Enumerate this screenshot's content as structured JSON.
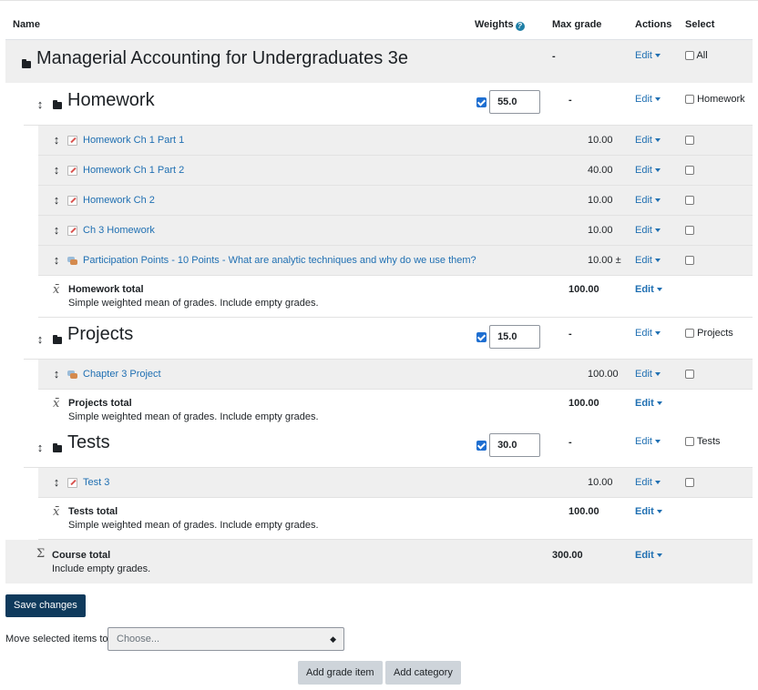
{
  "header": {
    "name": "Name",
    "weights": "Weights",
    "max_grade": "Max grade",
    "actions": "Actions",
    "select": "Select"
  },
  "course": {
    "title": "Managerial Accounting for Undergraduates 3e",
    "max": "-",
    "edit": "Edit",
    "select_label": "All"
  },
  "categories": [
    {
      "name": "Homework",
      "weight": "55.0",
      "max": "-",
      "edit": "Edit",
      "select_label": "Homework",
      "items": [
        {
          "name": "Homework Ch 1 Part 1",
          "max": "10.00",
          "edit": "Edit",
          "icon": "assignment"
        },
        {
          "name": "Homework Ch 1 Part 2",
          "max": "40.00",
          "edit": "Edit",
          "icon": "assignment"
        },
        {
          "name": "Homework Ch 2",
          "max": "10.00",
          "edit": "Edit",
          "icon": "assignment"
        },
        {
          "name": "Ch 3 Homework",
          "max": "10.00",
          "edit": "Edit",
          "icon": "assignment"
        },
        {
          "name": "Participation Points - 10 Points - What are analytic techniques and why do we use them?",
          "max": "10.00 ±",
          "edit": "Edit",
          "icon": "forum"
        }
      ],
      "total": {
        "name": "Homework total",
        "desc": "Simple weighted mean of grades. Include empty grades.",
        "max": "100.00",
        "edit": "Edit"
      }
    },
    {
      "name": "Projects",
      "weight": "15.0",
      "max": "-",
      "edit": "Edit",
      "select_label": "Projects",
      "items": [
        {
          "name": "Chapter 3 Project",
          "max": "100.00",
          "edit": "Edit",
          "icon": "forum"
        }
      ],
      "total": {
        "name": "Projects total",
        "desc": "Simple weighted mean of grades. Include empty grades.",
        "max": "100.00",
        "edit": "Edit"
      }
    },
    {
      "name": "Tests",
      "weight": "30.0",
      "max": "-",
      "edit": "Edit",
      "select_label": "Tests",
      "items": [
        {
          "name": "Test 3",
          "max": "10.00",
          "edit": "Edit",
          "icon": "assignment"
        }
      ],
      "total": {
        "name": "Tests total",
        "desc": "Simple weighted mean of grades. Include empty grades.",
        "max": "100.00",
        "edit": "Edit"
      }
    }
  ],
  "course_total": {
    "name": "Course total",
    "desc": "Include empty grades.",
    "max": "300.00",
    "edit": "Edit"
  },
  "footer": {
    "save_label": "Save changes",
    "move_label": "Move selected items to",
    "move_placeholder": "Choose...",
    "add_item_label": "Add grade item",
    "add_category_label": "Add category"
  },
  "colors": {
    "link": "#1f6fb2",
    "primary_button": "#0f3a5c",
    "checkbox_checked": "#1f6fd1",
    "row_shade": "#efefef"
  }
}
